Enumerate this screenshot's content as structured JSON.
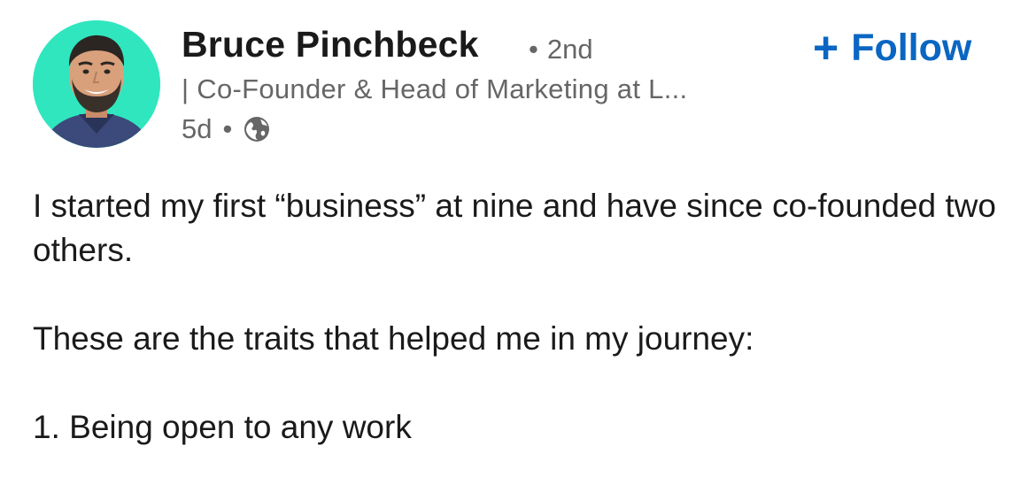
{
  "author": {
    "name": "Bruce Pinchbeck",
    "degree_separator": "•",
    "degree": "2nd",
    "headline": "| Co-Founder & Head of Marketing at L...",
    "time": "5d",
    "meta_separator": "•",
    "visibility_icon": "globe-icon",
    "avatar_bg": "#2fe6bf"
  },
  "follow": {
    "icon": "plus-icon",
    "plus": "+",
    "label": "Follow",
    "color": "#0a66c2"
  },
  "post": {
    "paragraphs": [
      "I started my first “business” at nine and have since co-founded two others.",
      "These are the traits that helped me in my journey:",
      "1. Being open to any work"
    ]
  }
}
